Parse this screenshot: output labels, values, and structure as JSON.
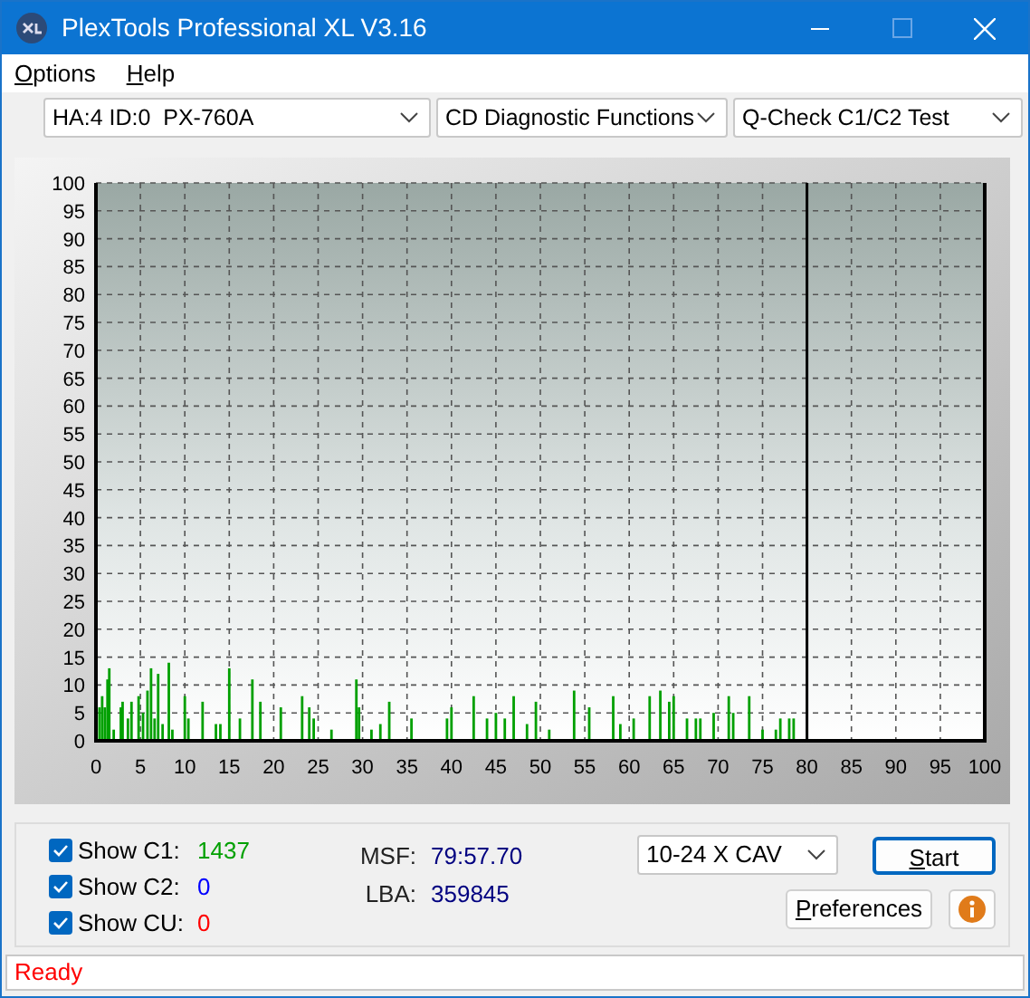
{
  "window": {
    "title": "PlexTools Professional XL V3.16"
  },
  "menu": [
    "Options",
    "Help"
  ],
  "selectors": [
    "HA:4 ID:0  PX-760A",
    "CD Diagnostic Functions",
    "Q-Check C1/C2 Test"
  ],
  "chart": {
    "chart_data": {
      "type": "bar",
      "xlim": [
        0,
        100
      ],
      "ylim": [
        0,
        100
      ],
      "xticks": [
        0,
        5,
        10,
        15,
        20,
        25,
        30,
        35,
        40,
        45,
        50,
        55,
        60,
        65,
        70,
        75,
        80,
        85,
        90,
        95,
        100
      ],
      "yticks": [
        0,
        5,
        10,
        15,
        20,
        25,
        30,
        35,
        40,
        45,
        50,
        55,
        60,
        65,
        70,
        75,
        80,
        85,
        90,
        95,
        100
      ],
      "grid": true,
      "ref_lines": [
        {
          "axis": "x",
          "value": 80
        }
      ],
      "x": [
        0.4,
        0.7,
        1,
        1.3,
        1.5,
        2,
        2.8,
        3,
        3.6,
        4,
        4.8,
        5.3,
        5.8,
        6.2,
        6.6,
        7,
        7.5,
        8.2,
        8.6,
        10,
        10.4,
        12,
        13.5,
        14,
        15,
        16.2,
        17.6,
        18.5,
        20.8,
        23.2,
        24,
        24.5,
        26.5,
        29.3,
        29.6,
        31,
        32,
        33,
        35.5,
        39.5,
        40,
        42.5,
        44,
        45,
        46,
        47,
        48.5,
        49.5,
        51,
        53.8,
        55.5,
        58.2,
        59,
        60.5,
        62.3,
        63.5,
        64.5,
        65,
        66.5,
        67.5,
        68,
        69.5,
        71.2,
        71.7,
        73.5,
        75,
        76.5,
        77,
        78,
        78.5
      ],
      "series": [
        {
          "color": "#00a000",
          "values": [
            6,
            8,
            6,
            11,
            13,
            2,
            6,
            7,
            4,
            7,
            8,
            5,
            9,
            13,
            4,
            12,
            3,
            14,
            2,
            8,
            4,
            7,
            3,
            3,
            13,
            4,
            11,
            7,
            6,
            8,
            6,
            4,
            2,
            11,
            6,
            2,
            3,
            7,
            4,
            4,
            6,
            8,
            4,
            5,
            4,
            8,
            3,
            7,
            2,
            9,
            6,
            8,
            3,
            4,
            8,
            9,
            7,
            8,
            4,
            4,
            4,
            5,
            8,
            5,
            8,
            2,
            2,
            4,
            4,
            4
          ]
        }
      ]
    }
  },
  "counters": [
    {
      "label": "Show C1:",
      "checked": true,
      "value": "1437",
      "color": "#00a000"
    },
    {
      "label": "Show C2:",
      "checked": true,
      "value": "0",
      "color": "#0000ff"
    },
    {
      "label": "Show CU:",
      "checked": true,
      "value": "0",
      "color": "#ff0000"
    }
  ],
  "position": [
    {
      "label": "MSF:",
      "value": "79:57.70"
    },
    {
      "label": "LBA:",
      "value": "359845"
    }
  ],
  "speed": "10-24 X CAV",
  "buttons": {
    "start": "Start",
    "preferences": "Preferences"
  },
  "status": "Ready"
}
